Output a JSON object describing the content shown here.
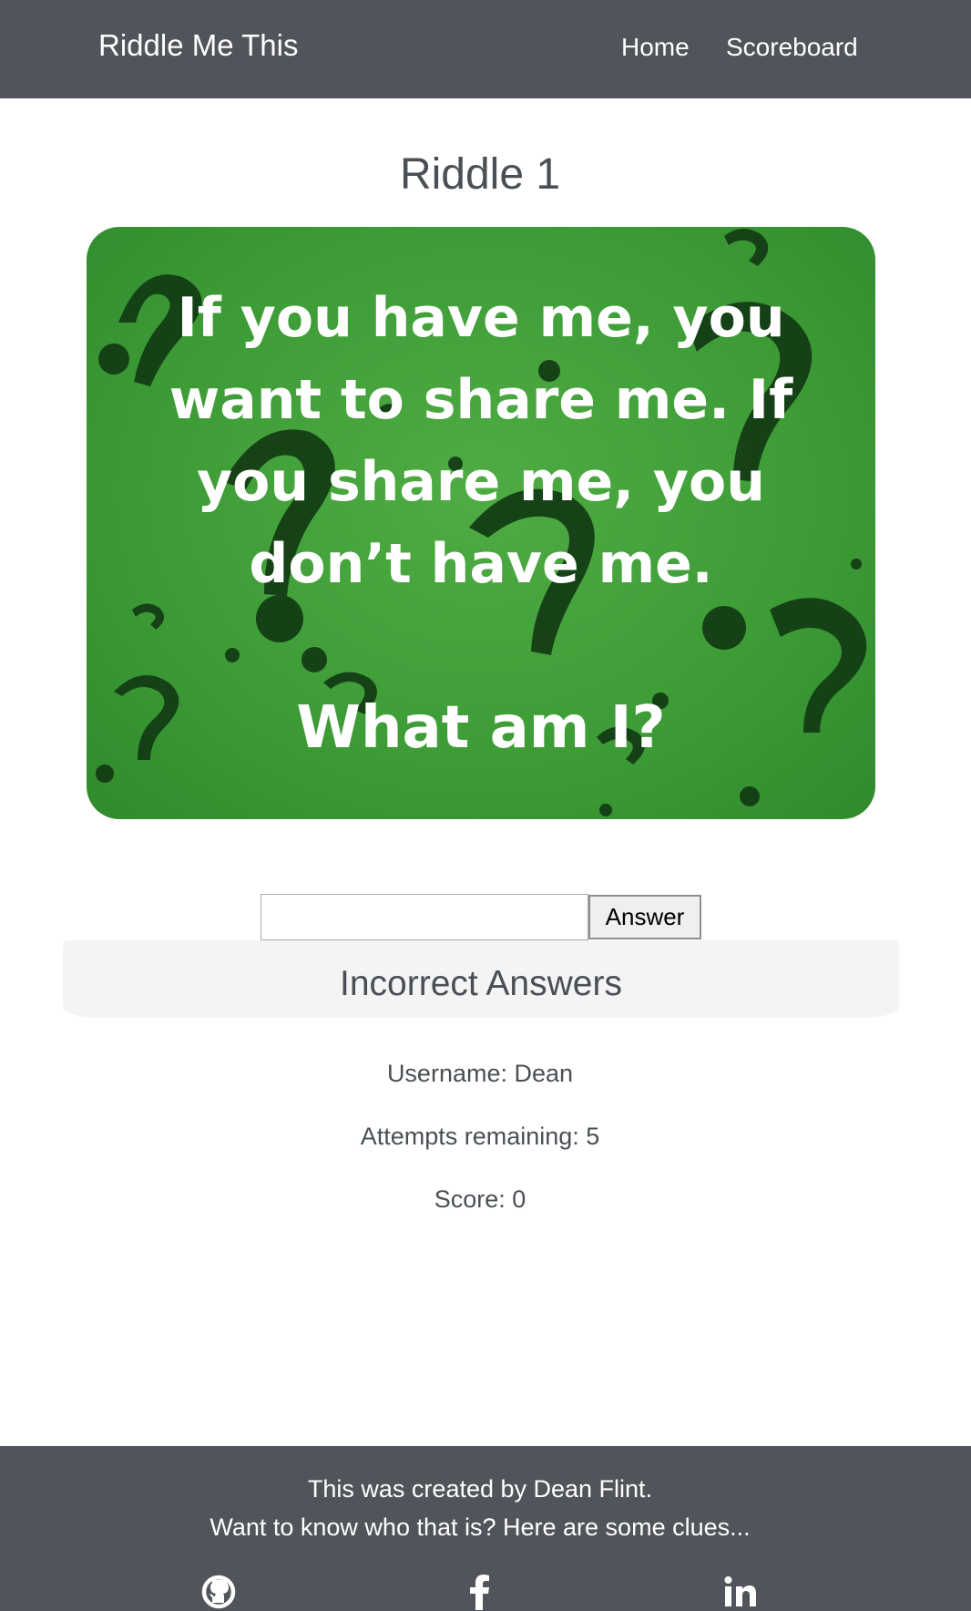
{
  "navbar": {
    "brand": "Riddle Me This",
    "links": [
      {
        "label": "Home"
      },
      {
        "label": "Scoreboard"
      }
    ]
  },
  "riddle": {
    "title": "Riddle 1",
    "image_text_lines": [
      "If you have me, you",
      "want to share me. If",
      "you share me, you",
      "don’t have me."
    ],
    "image_question": "What am I?",
    "image_colors": {
      "background": "#45a33d",
      "marks": "#123a14"
    }
  },
  "answer_form": {
    "input_value": "",
    "button_label": "Answer"
  },
  "incorrect": {
    "title": "Incorrect Answers"
  },
  "stats": {
    "username": "Username: Dean",
    "attempts": "Attempts remaining: 5",
    "score": "Score: 0"
  },
  "footer": {
    "line1": "This was created by Dean Flint.",
    "line2": "Want to know who that is? Here are some clues...",
    "social_icons": [
      "github-icon",
      "facebook-icon",
      "linkedin-icon"
    ]
  },
  "colors": {
    "navbar_bg": "#51545a",
    "text": "#4a4f55",
    "panel_bg": "#f4f4f4"
  }
}
